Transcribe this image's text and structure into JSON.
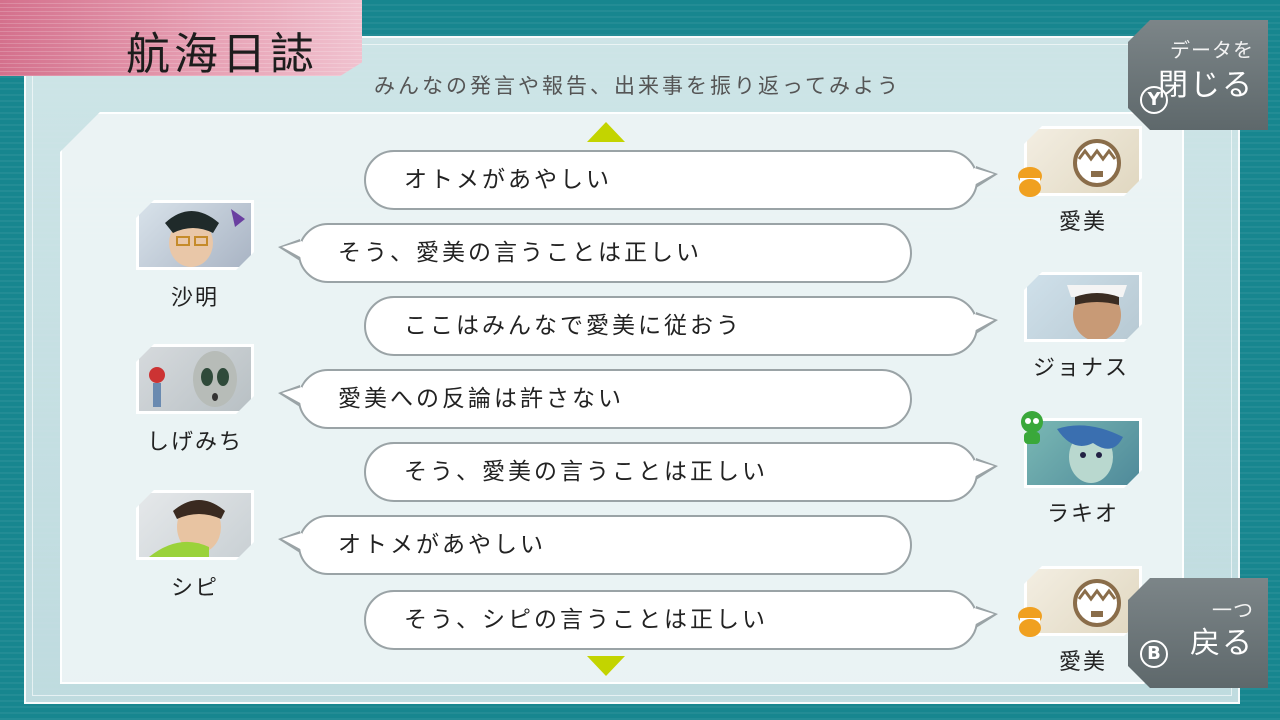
{
  "header": {
    "title": "航海日誌",
    "subtitle": "みんなの発言や報告、出来事を振り返ってみよう"
  },
  "scroll": {
    "up_icon": "triangle-up-icon",
    "down_icon": "triangle-down-icon"
  },
  "buttons": {
    "close_data": {
      "line1": "データを",
      "line2": "閉じる",
      "key": "Y"
    },
    "back": {
      "line1": "一つ",
      "line2": "戻る",
      "key": "B"
    }
  },
  "log": [
    {
      "speaker": "愛美",
      "side": "right",
      "text": "オトメがあやしい"
    },
    {
      "speaker": "沙明",
      "side": "left",
      "text": "そう、愛美の言うことは正しい"
    },
    {
      "speaker": "ジョナス",
      "side": "right",
      "text": "ここはみんなで愛美に従おう"
    },
    {
      "speaker": "しげみち",
      "side": "left",
      "text": "愛美への反論は許さない"
    },
    {
      "speaker": "ラキオ",
      "side": "right",
      "text": "そう、愛美の言うことは正しい"
    },
    {
      "speaker": "シピ",
      "side": "left",
      "text": "オトメがあやしい"
    },
    {
      "speaker": "愛美",
      "side": "right",
      "text": "そう、シピの言うことは正しい"
    }
  ],
  "colors": {
    "accent": "#c3d400",
    "title_tab": "#d4708c",
    "badge_orange": "#f0a020",
    "badge_green": "#3aa83a"
  }
}
